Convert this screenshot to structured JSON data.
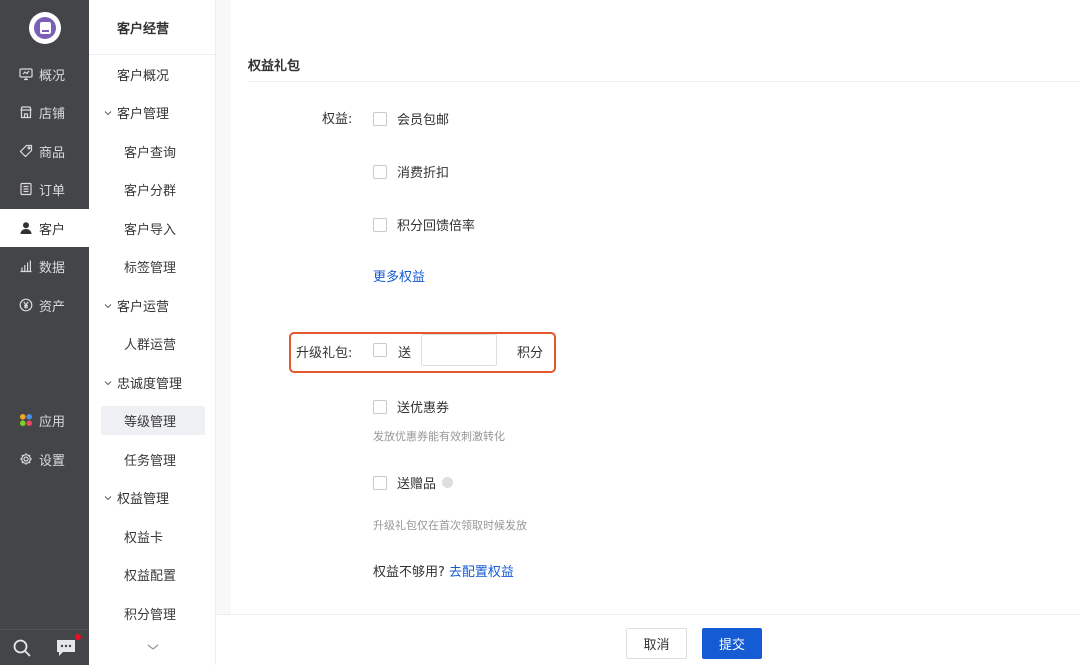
{
  "colors": {
    "nav_bg": "#444549",
    "accent": "#155bd4",
    "highlight": "#e4572e"
  },
  "nav1": {
    "items": [
      {
        "label": "概况",
        "icon": "monitor-icon"
      },
      {
        "label": "店铺",
        "icon": "store-icon"
      },
      {
        "label": "商品",
        "icon": "tag-icon"
      },
      {
        "label": "订单",
        "icon": "order-list-icon"
      },
      {
        "label": "客户",
        "icon": "user-icon",
        "active": true
      },
      {
        "label": "数据",
        "icon": "bar-chart-icon"
      },
      {
        "label": "资产",
        "icon": "yen-icon"
      },
      {
        "label": "应用",
        "icon": "apps-icon"
      },
      {
        "label": "设置",
        "icon": "gear-icon"
      }
    ],
    "bottom": {
      "search_icon": "search-icon",
      "message_icon": "message-icon"
    }
  },
  "nav2": {
    "title": "客户经营",
    "items": [
      {
        "label": "客户概况"
      },
      {
        "label": "客户管理"
      },
      {
        "label": "客户查询"
      },
      {
        "label": "客户分群"
      },
      {
        "label": "客户导入"
      },
      {
        "label": "标签管理"
      },
      {
        "label": "客户运营"
      },
      {
        "label": "人群运营"
      },
      {
        "label": "忠诚度管理"
      },
      {
        "label": "等级管理"
      },
      {
        "label": "任务管理"
      },
      {
        "label": "权益管理"
      },
      {
        "label": "权益卡"
      },
      {
        "label": "权益配置"
      },
      {
        "label": "积分管理"
      }
    ]
  },
  "main": {
    "section_title": "权益礼包",
    "benefits": {
      "label": "权益:",
      "options": [
        "会员包邮",
        "消费折扣",
        "积分回馈倍率"
      ],
      "more_link": "更多权益"
    },
    "upgrade": {
      "label": "升级礼包:",
      "send_label": "送",
      "points_value": "",
      "points_unit": "积分",
      "coupon_label": "送优惠券",
      "coupon_hint": "发放优惠券能有效刺激转化",
      "gift_label": "送赠品",
      "gift_hint": "升级礼包仅在首次领取时候发放"
    },
    "question": {
      "text": "权益不够用?",
      "link": "去配置权益"
    }
  },
  "footer": {
    "cancel": "取消",
    "submit": "提交"
  }
}
